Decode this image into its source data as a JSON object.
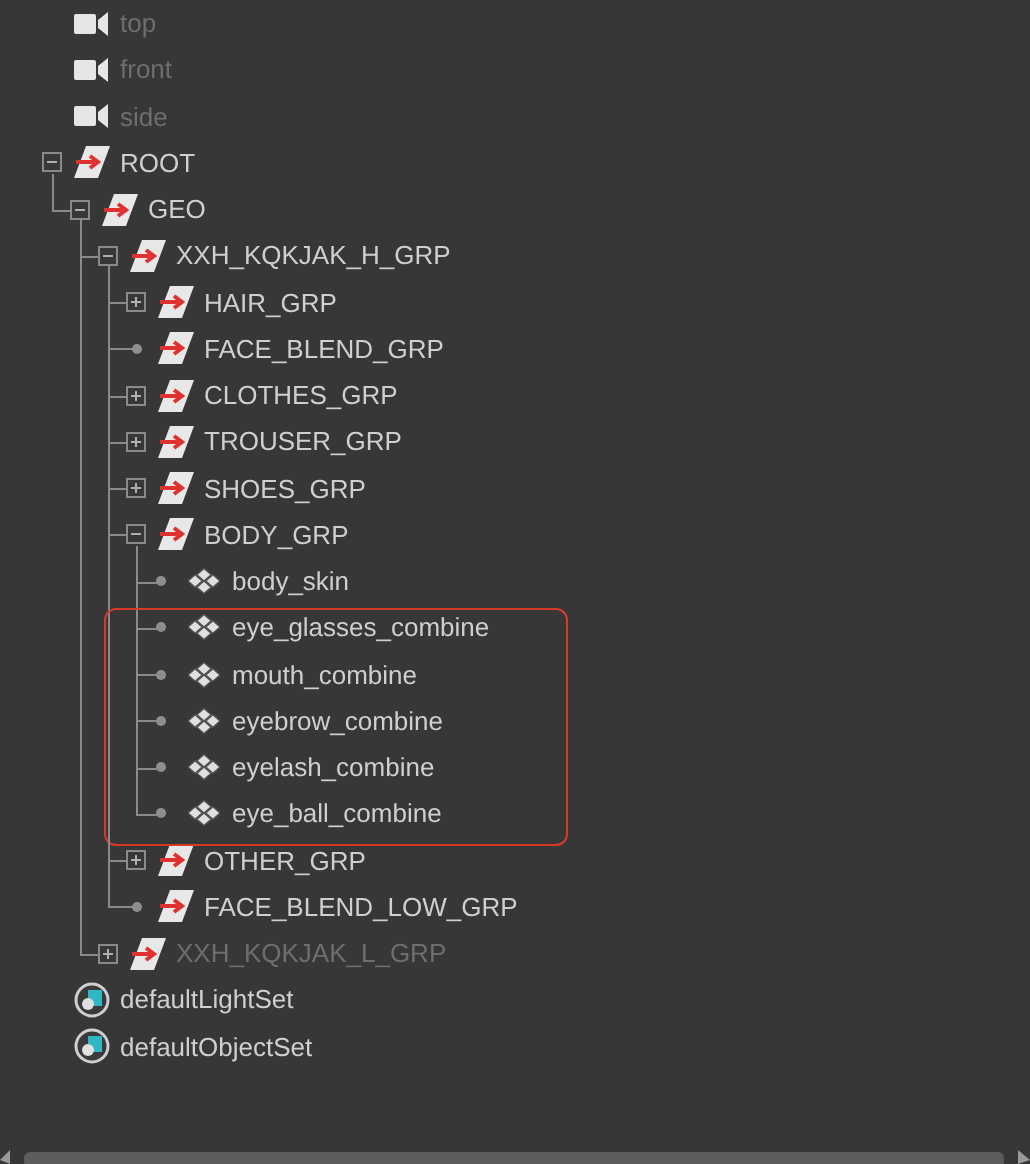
{
  "items": [
    {
      "kind": "camera",
      "label": "top",
      "hidden": true
    },
    {
      "kind": "camera",
      "label": "front",
      "hidden": true
    },
    {
      "kind": "camera",
      "label": "side",
      "hidden": true
    },
    {
      "kind": "group",
      "label": "ROOT",
      "hidden": false,
      "expanded": true,
      "children": [
        {
          "kind": "group",
          "label": "GEO",
          "hidden": false,
          "expanded": true,
          "children": [
            {
              "kind": "group",
              "label": "XXH_KQKJAK_H_GRP",
              "hidden": false,
              "expanded": true,
              "children": [
                {
                  "kind": "group",
                  "label": "HAIR_GRP",
                  "hidden": false,
                  "expanded": false
                },
                {
                  "kind": "group",
                  "label": "FACE_BLEND_GRP",
                  "hidden": false
                },
                {
                  "kind": "group",
                  "label": "CLOTHES_GRP",
                  "hidden": false,
                  "expanded": false
                },
                {
                  "kind": "group",
                  "label": "TROUSER_GRP",
                  "hidden": false,
                  "expanded": false
                },
                {
                  "kind": "group",
                  "label": "SHOES_GRP",
                  "hidden": false,
                  "expanded": false
                },
                {
                  "kind": "group",
                  "label": "BODY_GRP",
                  "hidden": false,
                  "expanded": true,
                  "children": [
                    {
                      "kind": "mesh",
                      "label": "body_skin",
                      "hidden": false,
                      "marked": false
                    },
                    {
                      "kind": "mesh",
                      "label": "eye_glasses_combine",
                      "hidden": false,
                      "marked": true
                    },
                    {
                      "kind": "mesh",
                      "label": "mouth_combine",
                      "hidden": false,
                      "marked": true
                    },
                    {
                      "kind": "mesh",
                      "label": "eyebrow_combine",
                      "hidden": false,
                      "marked": true
                    },
                    {
                      "kind": "mesh",
                      "label": "eyelash_combine",
                      "hidden": false,
                      "marked": true
                    },
                    {
                      "kind": "mesh",
                      "label": "eye_ball_combine",
                      "hidden": false,
                      "marked": true
                    }
                  ]
                },
                {
                  "kind": "group",
                  "label": "OTHER_GRP",
                  "hidden": false,
                  "expanded": false
                },
                {
                  "kind": "group",
                  "label": "FACE_BLEND_LOW_GRP",
                  "hidden": false
                }
              ]
            },
            {
              "kind": "group",
              "label": "XXH_KQKJAK_L_GRP",
              "hidden": true,
              "expanded": false
            }
          ]
        }
      ]
    },
    {
      "kind": "set",
      "label": "defaultLightSet",
      "hidden": false
    },
    {
      "kind": "set",
      "label": "defaultObjectSet",
      "hidden": false
    }
  ]
}
